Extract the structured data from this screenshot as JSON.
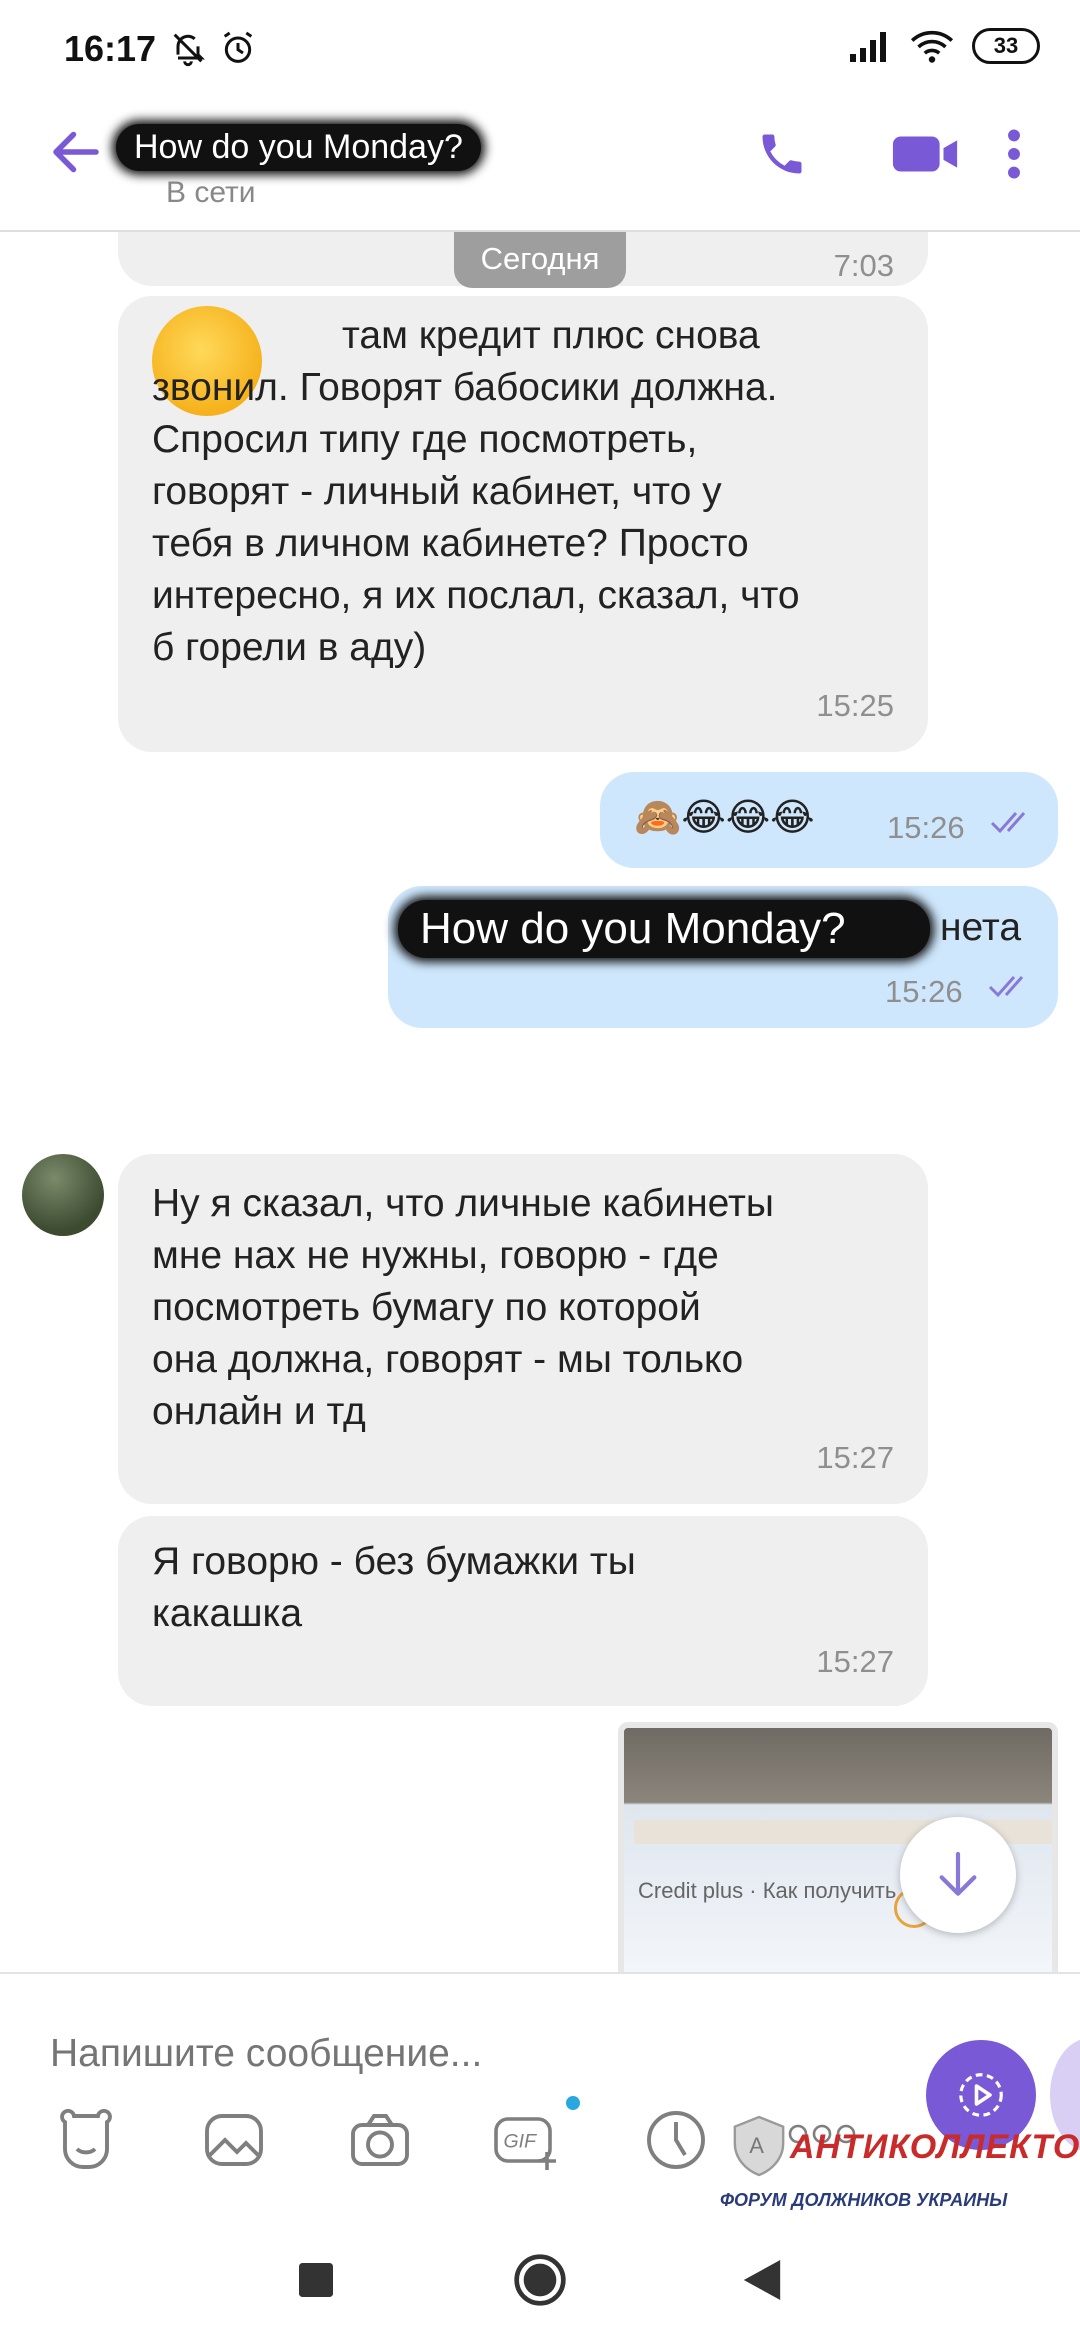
{
  "status_bar": {
    "time": "16:17",
    "battery": "33",
    "icons": [
      "mute-bell-icon",
      "alarm-icon",
      "signal-icon",
      "wifi-icon",
      "battery-icon"
    ]
  },
  "header": {
    "contact_name": "How do you Monday?",
    "status": "В сети",
    "actions": [
      "phone-icon",
      "video-icon",
      "more-icon"
    ]
  },
  "chat": {
    "date_divider": "Сегодня",
    "top_partial_time": "7:03",
    "messages": [
      {
        "direction": "incoming",
        "text": "там кредит плюс снова\nзвонил. Говорят бабосики должна.\nСпросил типу где посмотреть,\nговорят - личный кабинет, что у\nтебя в личном кабинете? Просто\nинтересно, я их послал, сказал, что\nб горели в аду)",
        "time": "15:25"
      },
      {
        "direction": "outgoing",
        "text": "🙈😂😂😂",
        "time": "15:26",
        "status": "read"
      },
      {
        "direction": "outgoing",
        "redacted_text": "How do you Monday?",
        "text_tail": "нета",
        "time": "15:26",
        "status": "read"
      },
      {
        "direction": "incoming",
        "text": "Ну я сказал, что личные кабинеты\nмне нах не нужны, говорю - где\nпосмотреть бумагу по которой\nона должна, говорят - мы только\nонлайн и тд",
        "time": "15:27"
      },
      {
        "direction": "incoming",
        "text": "Я говорю - без бумажки ты\nкакашка",
        "time": "15:27"
      }
    ],
    "photo_message": {
      "direction": "outgoing",
      "thumb_text": "Credit plus · Как получить"
    }
  },
  "composer": {
    "placeholder": "Напишите сообщение...",
    "tools": [
      "sticker-icon",
      "gallery-icon",
      "camera-icon",
      "gif-icon",
      "clock-icon",
      "more-dots-icon"
    ]
  },
  "watermark": {
    "title": "АНТИКОЛЛЕКТОР",
    "subtitle": "ФОРУМ ДОЛЖНИКОВ УКРАИНЫ"
  },
  "colors": {
    "accent": "#7a59d6",
    "incoming_bubble": "#efefef",
    "outgoing_bubble": "#cfe7fd",
    "time_text": "#8f8f8f"
  }
}
